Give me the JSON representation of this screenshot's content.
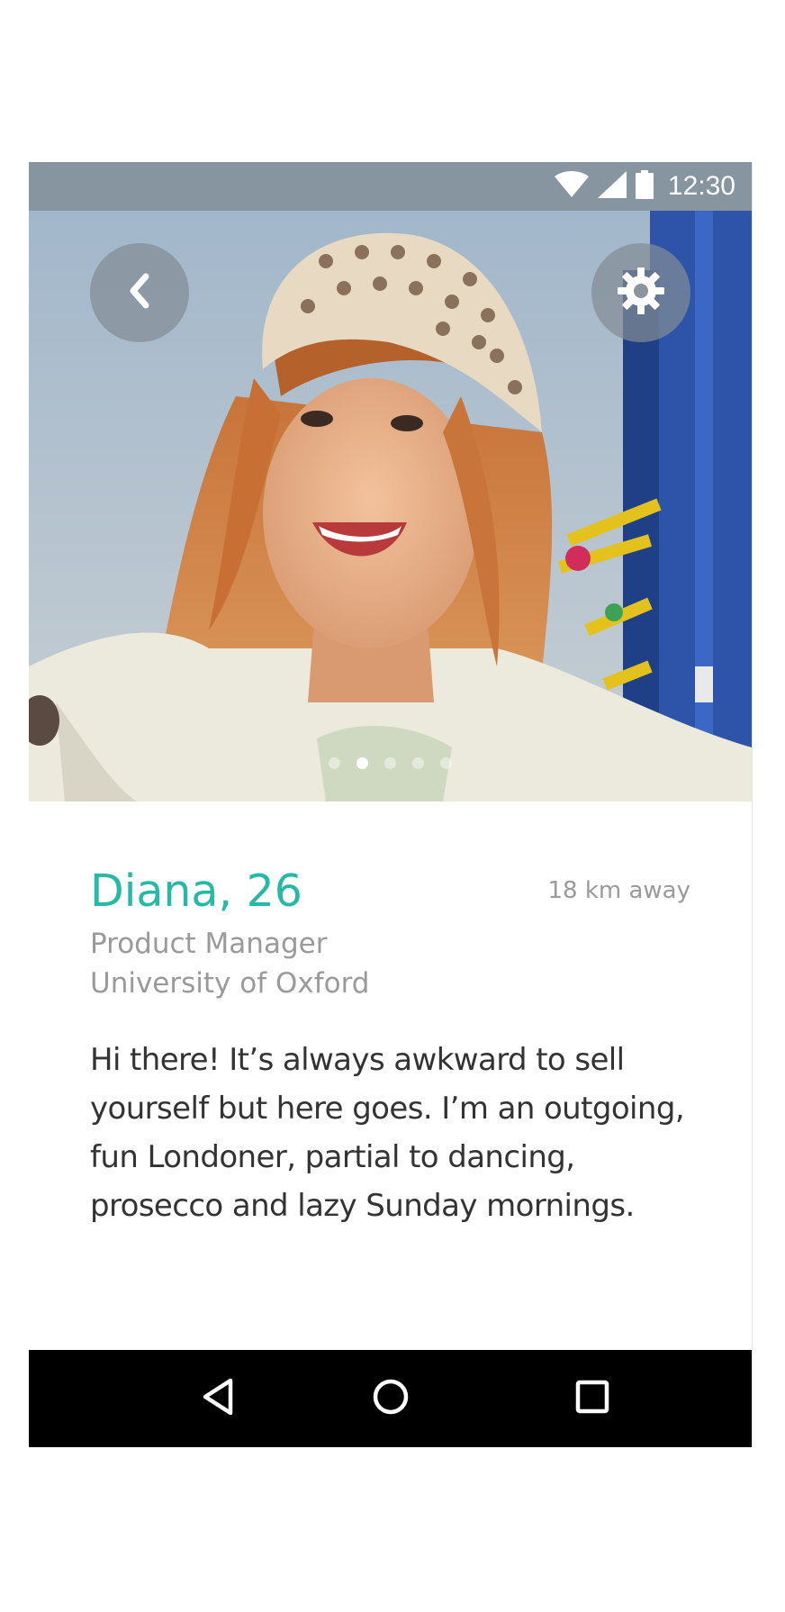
{
  "status_bar": {
    "time": "12:30",
    "icons": [
      "wifi-icon",
      "cell-signal-icon",
      "battery-icon"
    ]
  },
  "photo": {
    "page_count": 5,
    "active_page": 2
  },
  "header_buttons": {
    "back_icon": "chevron-left-icon",
    "settings_icon": "gear-icon"
  },
  "profile": {
    "name_age": "Diana, 26",
    "distance": "18 km away",
    "job": "Product Manager",
    "school": "University of Oxford",
    "bio": "Hi there! It’s always awkward to sell yourself but here goes. I’m an outgoing, fun Londoner, partial to dancing, prosecco and lazy Sunday mornings."
  },
  "nav_bar": {
    "icons": [
      "back-triangle-icon",
      "home-circle-icon",
      "recents-square-icon"
    ]
  },
  "colors": {
    "accent": "#26b9a5",
    "status_bar": "#8795a1",
    "secondary_text": "#9a9a9a",
    "body_text": "#333333",
    "nav_bar": "#000000"
  }
}
